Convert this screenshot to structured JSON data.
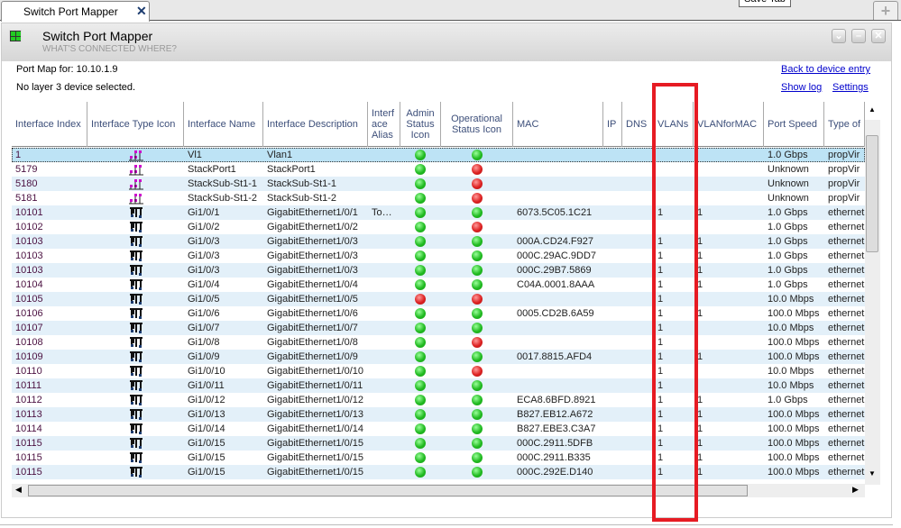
{
  "tabbar": {
    "tab_label": "Switch Port Mapper",
    "tooltip": "Save Tab"
  },
  "panel": {
    "title": "Switch Port Mapper",
    "subtitle": "WHAT'S CONNECTED WHERE?"
  },
  "info": {
    "port_map": "Port Map for: 10.10.1.9",
    "layer3": "No layer 3 device selected."
  },
  "links": {
    "back": "Back to device entry",
    "log": "Show log",
    "settings": "Settings"
  },
  "columns": [
    "Interface Index",
    "Interface Type Icon",
    "Interface Name",
    "Interface Description",
    "Interf ace Alias",
    "Admin Status Icon",
    "Operational Status Icon",
    "MAC",
    "IP",
    "DNS",
    "VLANs",
    "VLANforMAC",
    "Port Speed",
    "Type of"
  ],
  "colors": {
    "highlight": "#e61b23",
    "up": "#22bb22",
    "down": "#dd2222",
    "virtual_icon": "#cc00cc",
    "ethernet_icon": "#1b3b6f"
  },
  "rows": [
    {
      "index": "1",
      "icon": "virtual-interface-icon",
      "name": "Vl1",
      "desc": "Vlan1",
      "alias": "",
      "admin": "up",
      "oper": "up",
      "mac": "",
      "vlans": "",
      "vlanformac": "",
      "speed": "1.0 Gbps",
      "type": "propVir"
    },
    {
      "index": "5179",
      "icon": "virtual-interface-icon",
      "name": "StackPort1",
      "desc": "StackPort1",
      "alias": "",
      "admin": "up",
      "oper": "down",
      "mac": "",
      "vlans": "",
      "vlanformac": "",
      "speed": "Unknown",
      "type": "propVir"
    },
    {
      "index": "5180",
      "icon": "virtual-interface-icon",
      "name": "StackSub-St1-1",
      "desc": "StackSub-St1-1",
      "alias": "",
      "admin": "up",
      "oper": "down",
      "mac": "",
      "vlans": "",
      "vlanformac": "",
      "speed": "Unknown",
      "type": "propVir"
    },
    {
      "index": "5181",
      "icon": "virtual-interface-icon",
      "name": "StackSub-St1-2",
      "desc": "StackSub-St1-2",
      "alias": "",
      "admin": "up",
      "oper": "down",
      "mac": "",
      "vlans": "",
      "vlanformac": "",
      "speed": "Unknown",
      "type": "propVir"
    },
    {
      "index": "10101",
      "icon": "ethernet-interface-icon",
      "name": "Gi1/0/1",
      "desc": "GigabitEthernet1/0/1",
      "alias": "To…",
      "admin": "up",
      "oper": "up",
      "mac": "6073.5C05.1C21",
      "vlans": "1",
      "vlanformac": "1",
      "speed": "1.0 Gbps",
      "type": "ethernet"
    },
    {
      "index": "10102",
      "icon": "ethernet-interface-icon",
      "name": "Gi1/0/2",
      "desc": "GigabitEthernet1/0/2",
      "alias": "",
      "admin": "up",
      "oper": "down",
      "mac": "",
      "vlans": "",
      "vlanformac": "",
      "speed": "1.0 Gbps",
      "type": "ethernet"
    },
    {
      "index": "10103",
      "icon": "ethernet-interface-icon",
      "name": "Gi1/0/3",
      "desc": "GigabitEthernet1/0/3",
      "alias": "",
      "admin": "up",
      "oper": "up",
      "mac": "000A.CD24.F927",
      "vlans": "1",
      "vlanformac": "1",
      "speed": "1.0 Gbps",
      "type": "ethernet"
    },
    {
      "index": "10103",
      "icon": "ethernet-interface-icon",
      "name": "Gi1/0/3",
      "desc": "GigabitEthernet1/0/3",
      "alias": "",
      "admin": "up",
      "oper": "up",
      "mac": "000C.29AC.9DD7",
      "vlans": "1",
      "vlanformac": "1",
      "speed": "1.0 Gbps",
      "type": "ethernet"
    },
    {
      "index": "10103",
      "icon": "ethernet-interface-icon",
      "name": "Gi1/0/3",
      "desc": "GigabitEthernet1/0/3",
      "alias": "",
      "admin": "up",
      "oper": "up",
      "mac": "000C.29B7.5869",
      "vlans": "1",
      "vlanformac": "1",
      "speed": "1.0 Gbps",
      "type": "ethernet"
    },
    {
      "index": "10104",
      "icon": "ethernet-interface-icon",
      "name": "Gi1/0/4",
      "desc": "GigabitEthernet1/0/4",
      "alias": "",
      "admin": "up",
      "oper": "up",
      "mac": "C04A.0001.8AAA",
      "vlans": "1",
      "vlanformac": "1",
      "speed": "1.0 Gbps",
      "type": "ethernet"
    },
    {
      "index": "10105",
      "icon": "ethernet-interface-icon",
      "name": "Gi1/0/5",
      "desc": "GigabitEthernet1/0/5",
      "alias": "",
      "admin": "down",
      "oper": "down",
      "mac": "",
      "vlans": "1",
      "vlanformac": "",
      "speed": "10.0 Mbps",
      "type": "ethernet"
    },
    {
      "index": "10106",
      "icon": "ethernet-interface-icon",
      "name": "Gi1/0/6",
      "desc": "GigabitEthernet1/0/6",
      "alias": "",
      "admin": "up",
      "oper": "up",
      "mac": "0005.CD2B.6A59",
      "vlans": "1",
      "vlanformac": "1",
      "speed": "100.0 Mbps",
      "type": "ethernet"
    },
    {
      "index": "10107",
      "icon": "ethernet-interface-icon",
      "name": "Gi1/0/7",
      "desc": "GigabitEthernet1/0/7",
      "alias": "",
      "admin": "up",
      "oper": "up",
      "mac": "",
      "vlans": "1",
      "vlanformac": "",
      "speed": "10.0 Mbps",
      "type": "ethernet"
    },
    {
      "index": "10108",
      "icon": "ethernet-interface-icon",
      "name": "Gi1/0/8",
      "desc": "GigabitEthernet1/0/8",
      "alias": "",
      "admin": "up",
      "oper": "down",
      "mac": "",
      "vlans": "1",
      "vlanformac": "",
      "speed": "100.0 Mbps",
      "type": "ethernet"
    },
    {
      "index": "10109",
      "icon": "ethernet-interface-icon",
      "name": "Gi1/0/9",
      "desc": "GigabitEthernet1/0/9",
      "alias": "",
      "admin": "up",
      "oper": "up",
      "mac": "0017.8815.AFD4",
      "vlans": "1",
      "vlanformac": "1",
      "speed": "100.0 Mbps",
      "type": "ethernet"
    },
    {
      "index": "10110",
      "icon": "ethernet-interface-icon",
      "name": "Gi1/0/10",
      "desc": "GigabitEthernet1/0/10",
      "alias": "",
      "admin": "up",
      "oper": "down",
      "mac": "",
      "vlans": "1",
      "vlanformac": "",
      "speed": "10.0 Mbps",
      "type": "ethernet"
    },
    {
      "index": "10111",
      "icon": "ethernet-interface-icon",
      "name": "Gi1/0/11",
      "desc": "GigabitEthernet1/0/11",
      "alias": "",
      "admin": "up",
      "oper": "up",
      "mac": "",
      "vlans": "1",
      "vlanformac": "",
      "speed": "10.0 Mbps",
      "type": "ethernet"
    },
    {
      "index": "10112",
      "icon": "ethernet-interface-icon",
      "name": "Gi1/0/12",
      "desc": "GigabitEthernet1/0/12",
      "alias": "",
      "admin": "up",
      "oper": "up",
      "mac": "ECA8.6BFD.8921",
      "vlans": "1",
      "vlanformac": "1",
      "speed": "1.0 Gbps",
      "type": "ethernet"
    },
    {
      "index": "10113",
      "icon": "ethernet-interface-icon",
      "name": "Gi1/0/13",
      "desc": "GigabitEthernet1/0/13",
      "alias": "",
      "admin": "up",
      "oper": "up",
      "mac": "B827.EB12.A672",
      "vlans": "1",
      "vlanformac": "1",
      "speed": "100.0 Mbps",
      "type": "ethernet"
    },
    {
      "index": "10114",
      "icon": "ethernet-interface-icon",
      "name": "Gi1/0/14",
      "desc": "GigabitEthernet1/0/14",
      "alias": "",
      "admin": "up",
      "oper": "up",
      "mac": "B827.EBE3.C3A7",
      "vlans": "1",
      "vlanformac": "1",
      "speed": "100.0 Mbps",
      "type": "ethernet"
    },
    {
      "index": "10115",
      "icon": "ethernet-interface-icon",
      "name": "Gi1/0/15",
      "desc": "GigabitEthernet1/0/15",
      "alias": "",
      "admin": "up",
      "oper": "up",
      "mac": "000C.2911.5DFB",
      "vlans": "1",
      "vlanformac": "1",
      "speed": "100.0 Mbps",
      "type": "ethernet"
    },
    {
      "index": "10115",
      "icon": "ethernet-interface-icon",
      "name": "Gi1/0/15",
      "desc": "GigabitEthernet1/0/15",
      "alias": "",
      "admin": "up",
      "oper": "up",
      "mac": "000C.2911.B335",
      "vlans": "1",
      "vlanformac": "1",
      "speed": "100.0 Mbps",
      "type": "ethernet"
    },
    {
      "index": "10115",
      "icon": "ethernet-interface-icon",
      "name": "Gi1/0/15",
      "desc": "GigabitEthernet1/0/15",
      "alias": "",
      "admin": "up",
      "oper": "up",
      "mac": "000C.292E.D140",
      "vlans": "1",
      "vlanformac": "1",
      "speed": "100.0 Mbps",
      "type": "ethernet"
    }
  ]
}
